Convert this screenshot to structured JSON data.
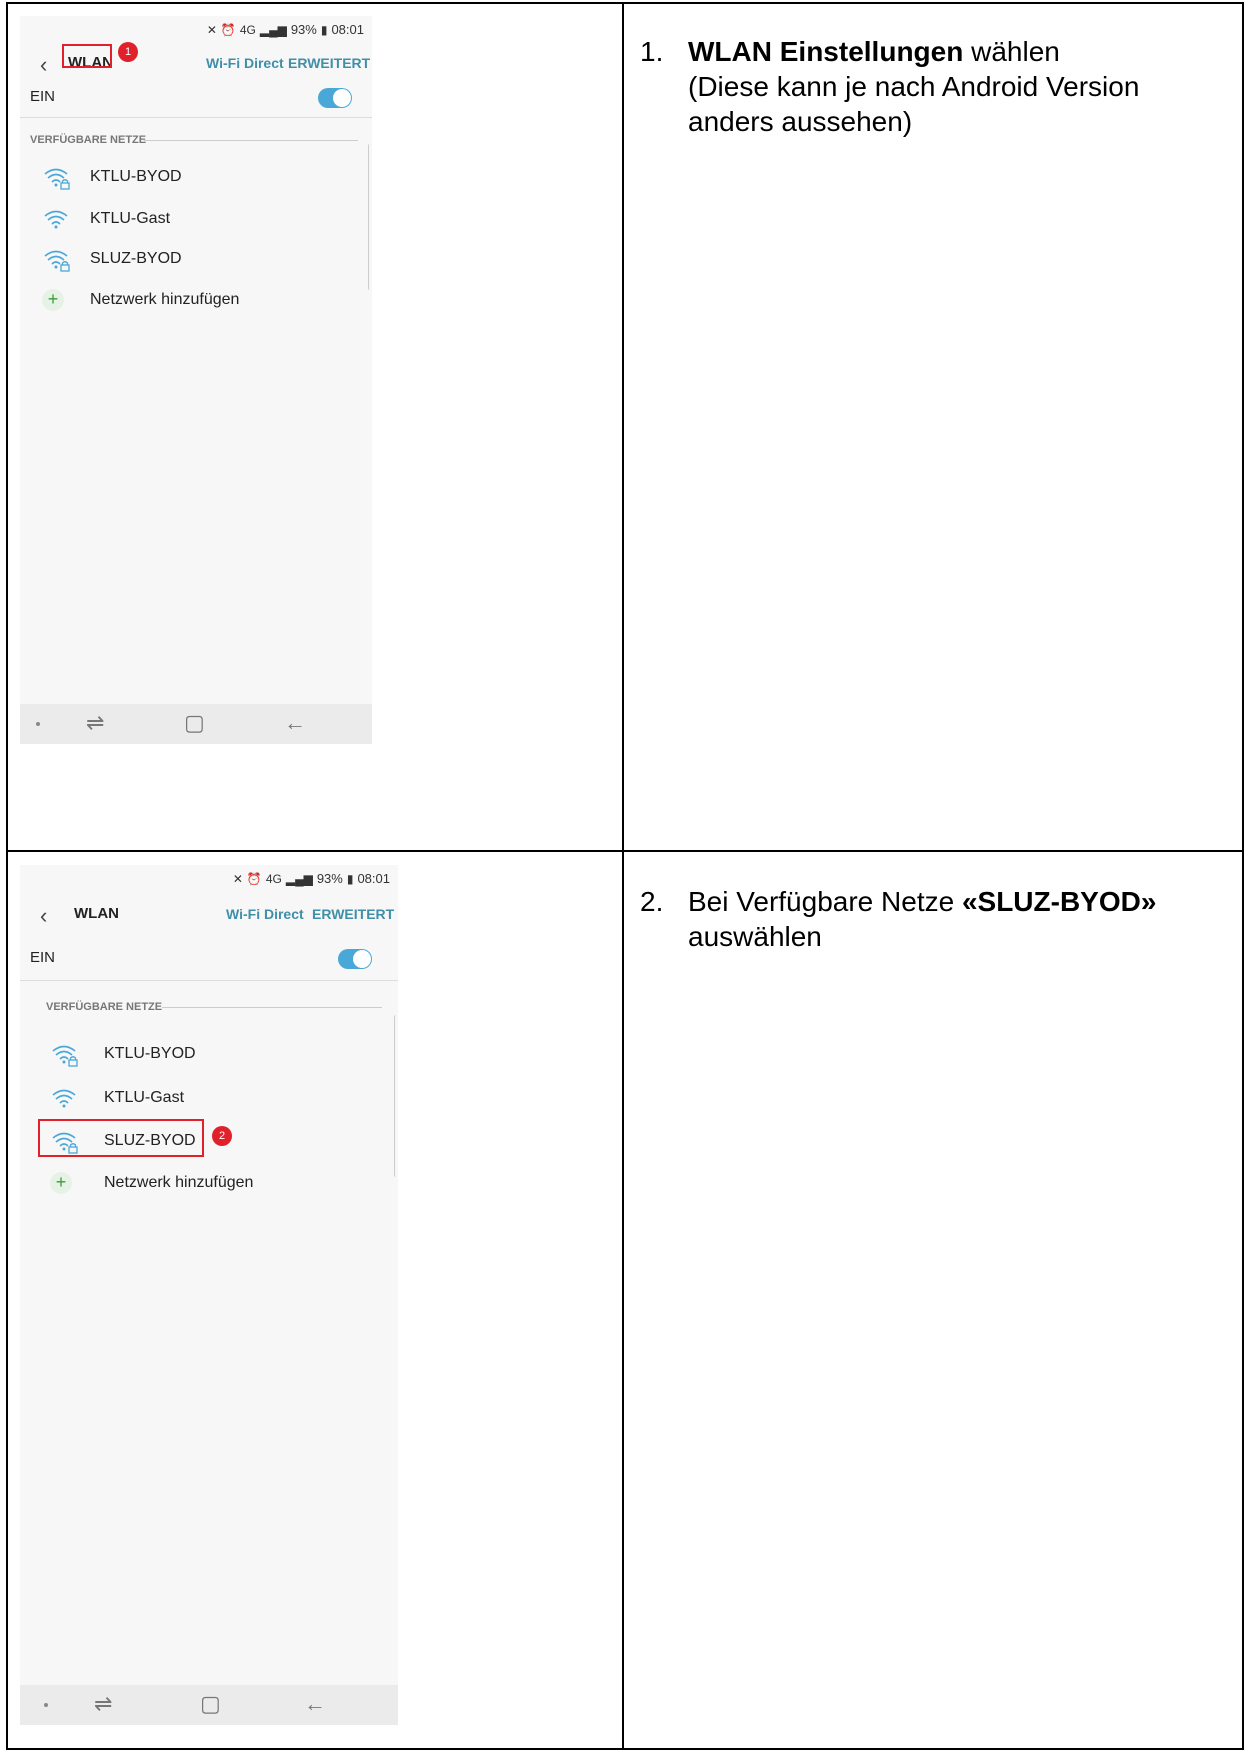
{
  "steps": [
    {
      "number": "1.",
      "bold": "WLAN Einstellungen",
      "rest": " wählen",
      "line2": "(Diese kann je nach Android Version anders aussehen)"
    },
    {
      "number": "2.",
      "prefix": "Bei Verfügbare Netze ",
      "bold": "«SLUZ-BYOD»",
      "rest": " auswählen"
    }
  ],
  "phone": {
    "status_battery": "93%",
    "status_time": "08:01",
    "status_network": "4G",
    "title": "WLAN",
    "wifi_direct": "Wi-Fi Direct",
    "erweitert": "ERWEITERT",
    "ein": "EIN",
    "section": "VERFÜGBARE NETZE",
    "networks": [
      "KTLU-BYOD",
      "KTLU-Gast",
      "SLUZ-BYOD"
    ],
    "add_network": "Netzwerk hinzufügen",
    "toggle_on": true
  },
  "badges": [
    "1",
    "2"
  ],
  "colors": {
    "accent": "#3f8fa8",
    "toggle": "#4aa8d8",
    "highlight": "#e0202a"
  },
  "icons": [
    "back-icon",
    "wifi-lock-icon",
    "wifi-icon",
    "plus-icon",
    "recents-icon",
    "home-icon",
    "nav-back-icon"
  ]
}
